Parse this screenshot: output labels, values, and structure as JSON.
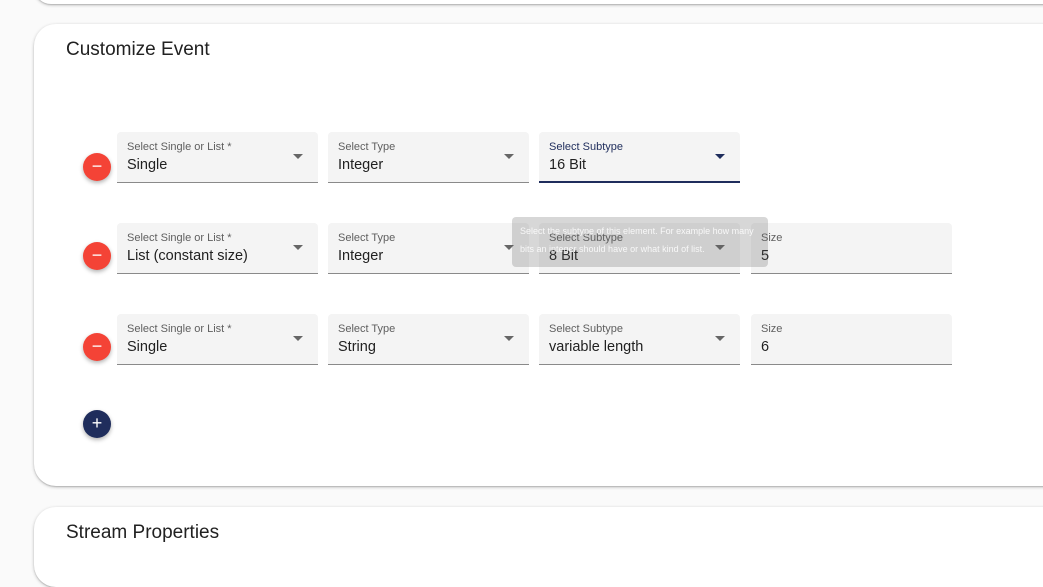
{
  "sections": {
    "customize_title": "Customize Event",
    "stream_title": "Stream Properties"
  },
  "rows": [
    {
      "single_or_list": {
        "label": "Select Single or List *",
        "value": "Single"
      },
      "type": {
        "label": "Select Type",
        "value": "Integer"
      },
      "subtype": {
        "label": "Select Subtype",
        "value": "16 Bit"
      }
    },
    {
      "single_or_list": {
        "label": "Select Single or List *",
        "value": "List (constant size)"
      },
      "type": {
        "label": "Select Type",
        "value": "Integer"
      },
      "subtype": {
        "label": "Select Subtype",
        "value": "8 Bit"
      },
      "size": {
        "label": "Size",
        "value": "5"
      }
    },
    {
      "single_or_list": {
        "label": "Select Single or List *",
        "value": "Single"
      },
      "type": {
        "label": "Select Type",
        "value": "String"
      },
      "subtype": {
        "label": "Select Subtype",
        "value": "variable length"
      },
      "size": {
        "label": "Size",
        "value": "6"
      }
    }
  ],
  "tooltip": "Select the subtype of this element. For example how many bits an integer should have or what kind of list.",
  "buttons": {
    "remove_glyph": "−",
    "add_glyph": "+"
  },
  "colors": {
    "remove": "#f44336",
    "add": "#1f2d5c",
    "focus": "#1f2d5c"
  }
}
